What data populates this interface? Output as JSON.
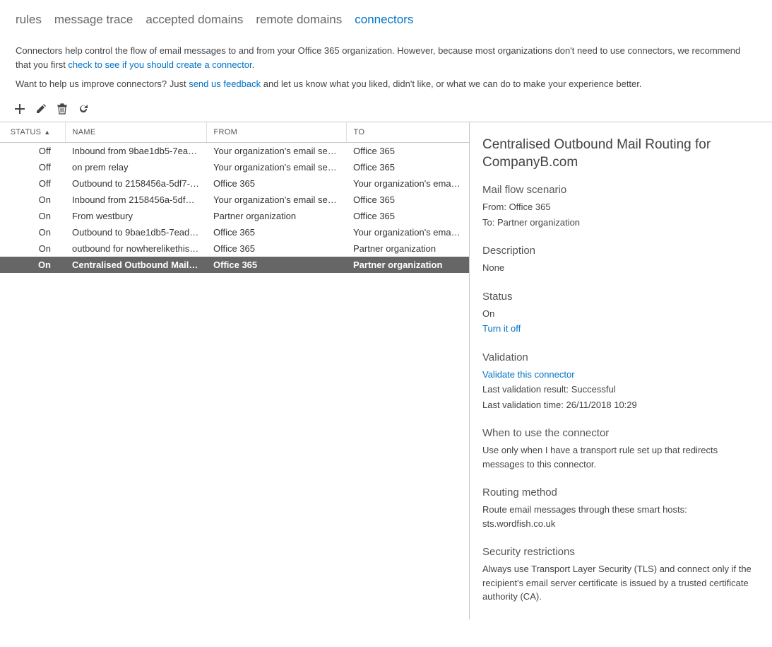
{
  "tabs": [
    {
      "label": "rules",
      "active": false
    },
    {
      "label": "message trace",
      "active": false
    },
    {
      "label": "accepted domains",
      "active": false
    },
    {
      "label": "remote domains",
      "active": false
    },
    {
      "label": "connectors",
      "active": true
    }
  ],
  "intro": {
    "text1": "Connectors help control the flow of email messages to and from your Office 365 organization. However, because most organizations don't need to use connectors, we recommend that you first ",
    "link": "check to see if you should create a connector",
    "text2": "."
  },
  "feedback": {
    "text1": "Want to help us improve connectors? Just ",
    "link": "send us feedback",
    "text2": " and let us know what you liked, didn't like, or what we can do to make your experience better."
  },
  "columns": {
    "status": "STATUS",
    "name": "NAME",
    "from": "FROM",
    "to": "TO"
  },
  "rows": [
    {
      "status": "Off",
      "name": "Inbound from 9bae1db5-7ead-4...",
      "from": "Your organization's email server",
      "to": "Office 365",
      "selected": false
    },
    {
      "status": "Off",
      "name": "on prem relay",
      "from": "Your organization's email server",
      "to": "Office 365",
      "selected": false
    },
    {
      "status": "Off",
      "name": "Outbound to 2158456a-5df7-45...",
      "from": "Office 365",
      "to": "Your organization's email s...",
      "selected": false
    },
    {
      "status": "On",
      "name": "Inbound from 2158456a-5df7-45...",
      "from": "Your organization's email server",
      "to": "Office 365",
      "selected": false
    },
    {
      "status": "On",
      "name": "From westbury",
      "from": "Partner organization",
      "to": "Office 365",
      "selected": false
    },
    {
      "status": "On",
      "name": "Outbound to 9bae1db5-7ead-4d...",
      "from": "Office 365",
      "to": "Your organization's email s...",
      "selected": false
    },
    {
      "status": "On",
      "name": "outbound for nowherelikethis12...",
      "from": "Office 365",
      "to": "Partner organization",
      "selected": false
    },
    {
      "status": "On",
      "name": "Centralised Outbound Mail Routi...",
      "from": "Office 365",
      "to": "Partner organization",
      "selected": true
    }
  ],
  "details": {
    "title": "Centralised Outbound Mail Routing for CompanyB.com",
    "scenario_heading": "Mail flow scenario",
    "from_label": "From: ",
    "from_value": "Office 365",
    "to_label": "To: ",
    "to_value": "Partner organization",
    "description_heading": "Description",
    "description_value": "None",
    "status_heading": "Status",
    "status_value": "On",
    "status_link": "Turn it off",
    "validation_heading": "Validation",
    "validation_link": "Validate this connector",
    "validation_result": "Last validation result: Successful",
    "validation_time": "Last validation time: 26/11/2018 10:29",
    "when_heading": "When to use the connector",
    "when_value": "Use only when I have a transport rule set up that redirects messages to this connector.",
    "routing_heading": "Routing method",
    "routing_value": "Route email messages through these smart hosts: sts.wordfish.co.uk",
    "security_heading": "Security restrictions",
    "security_value": "Always use Transport Layer Security (TLS) and connect only if the recipient's email server certificate is issued by a trusted certificate authority (CA)."
  }
}
